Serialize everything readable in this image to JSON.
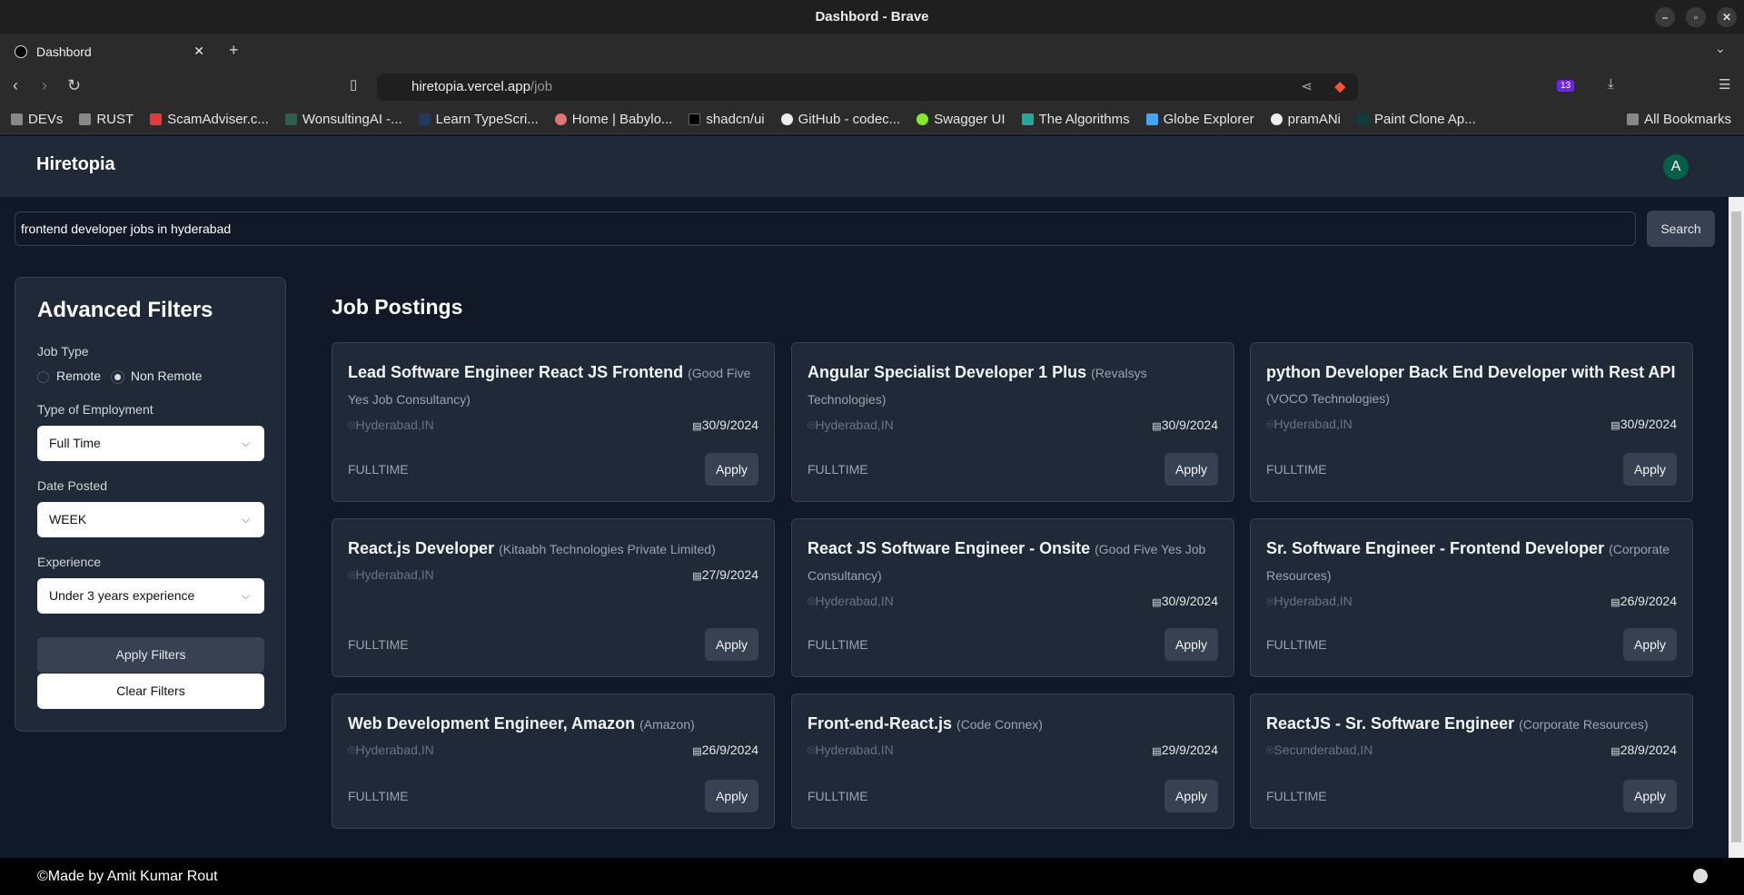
{
  "browser": {
    "window_title": "Dashbord - Brave",
    "tab_title": "Dashbord",
    "url_host": "hiretopia.vercel.app",
    "url_path": "/job",
    "extension_badge": "13",
    "bookmarks": [
      "DEVs",
      "RUST",
      "ScamAdviser.c...",
      "WonsultingAI -...",
      "Learn TypeScri...",
      "Home | Babylo...",
      "shadcn/ui",
      "GitHub - codec...",
      "Swagger UI",
      "The Algorithms",
      "Globe Explorer",
      "pramANi",
      "Paint Clone Ap..."
    ],
    "all_bookmarks": "All Bookmarks"
  },
  "header": {
    "logo": "Hiretopia",
    "avatar": "A"
  },
  "search": {
    "value": "frontend developer jobs in hyderabad",
    "button": "Search"
  },
  "filters": {
    "title": "Advanced Filters",
    "job_type_label": "Job Type",
    "remote": "Remote",
    "non_remote": "Non Remote",
    "selected_job_type": "Non Remote",
    "employment_label": "Type of Employment",
    "employment_value": "Full Time",
    "date_label": "Date Posted",
    "date_value": "WEEK",
    "experience_label": "Experience",
    "experience_value": "Under 3 years experience",
    "apply": "Apply Filters",
    "clear": "Clear Filters"
  },
  "jobs_title": "Job Postings",
  "jobs": [
    {
      "title": "Lead Software Engineer React JS Frontend",
      "company": "(Good Five Yes Job Consultancy)",
      "location": "Hyderabad,IN",
      "date": "30/9/2024",
      "type": "FULLTIME",
      "apply": "Apply"
    },
    {
      "title": "Angular Specialist Developer 1 Plus",
      "company": "(Revalsys Technologies)",
      "location": "Hyderabad,IN",
      "date": "30/9/2024",
      "type": "FULLTIME",
      "apply": "Apply"
    },
    {
      "title": "python Developer Back End Developer with Rest API",
      "company": "(VOCO Technologies)",
      "location": "Hyderabad,IN",
      "date": "30/9/2024",
      "type": "FULLTIME",
      "apply": "Apply"
    },
    {
      "title": "React.js Developer",
      "company": "(Kitaabh Technologies Private Limited)",
      "location": "Hyderabad,IN",
      "date": "27/9/2024",
      "type": "FULLTIME",
      "apply": "Apply"
    },
    {
      "title": "React JS Software Engineer - Onsite",
      "company": "(Good Five Yes Job Consultancy)",
      "location": "Hyderabad,IN",
      "date": "30/9/2024",
      "type": "FULLTIME",
      "apply": "Apply"
    },
    {
      "title": "Sr. Software Engineer - Frontend Developer",
      "company": "(Corporate Resources)",
      "location": "Hyderabad,IN",
      "date": "26/9/2024",
      "type": "FULLTIME",
      "apply": "Apply"
    },
    {
      "title": "Web Development Engineer, Amazon",
      "company": "(Amazon)",
      "location": "Hyderabad,IN",
      "date": "26/9/2024",
      "type": "FULLTIME",
      "apply": "Apply"
    },
    {
      "title": "Front-end-React.js",
      "company": "(Code Connex)",
      "location": "Hyderabad,IN",
      "date": "29/9/2024",
      "type": "FULLTIME",
      "apply": "Apply"
    },
    {
      "title": "ReactJS - Sr. Software Engineer",
      "company": "(Corporate Resources)",
      "location": "Secunderabad,IN",
      "date": "28/9/2024",
      "type": "FULLTIME",
      "apply": "Apply"
    }
  ],
  "footer": {
    "text": "©Made by Amit Kumar Rout"
  }
}
